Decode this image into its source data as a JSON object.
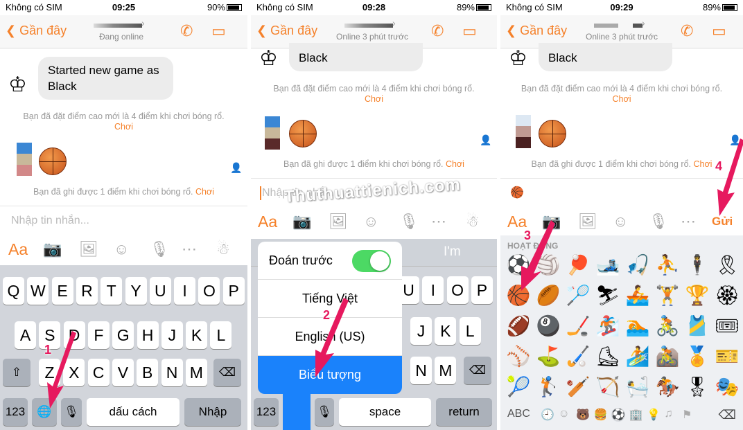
{
  "panels": [
    {
      "carrier": "Không có SIM",
      "time": "09:25",
      "battery": "90%",
      "back": "Gần đây",
      "subtitle": "Đang online"
    },
    {
      "carrier": "Không có SIM",
      "time": "09:28",
      "battery": "89%",
      "back": "Gần đây",
      "subtitle": "Online 3 phút trước"
    },
    {
      "carrier": "Không có SIM",
      "time": "09:29",
      "battery": "89%",
      "back": "Gần đây",
      "subtitle": "Online 3 phút trước"
    }
  ],
  "chat": {
    "game_message": "Started new game as Black",
    "game_message_short": "Black",
    "highscore": "Bạn đã đặt điểm cao mới là 4 điểm khi chơi bóng rổ.",
    "score": "Bạn đã ghi được 1 điểm khi chơi bóng rổ.",
    "play_link": "Chơi",
    "placeholder": "Nhập tin nhắn...",
    "input_value_panel3": "🏀",
    "send": "Gửi",
    "aa": "Aa"
  },
  "keyboard1": {
    "row1": [
      "Q",
      "W",
      "E",
      "R",
      "T",
      "Y",
      "U",
      "I",
      "O",
      "P"
    ],
    "row2": [
      "A",
      "S",
      "D",
      "F",
      "G",
      "H",
      "J",
      "K",
      "L"
    ],
    "row3": [
      "Z",
      "X",
      "C",
      "V",
      "B",
      "N",
      "M"
    ],
    "numbers": "123",
    "space": "dấu cách",
    "return": "Nhập"
  },
  "keyboard2": {
    "suggestion": "I'm",
    "row1": [
      "U",
      "I",
      "O",
      "P"
    ],
    "row2": [
      "J",
      "K",
      "L"
    ],
    "row3": [
      "N",
      "M"
    ],
    "numbers": "123",
    "space": "space",
    "return": "return",
    "menu": {
      "predictive": "Đoán trước",
      "predictive_on": true,
      "options": [
        "Tiếng Việt",
        "English (US)",
        "Biểu tượng"
      ],
      "selected": "Biểu tượng"
    }
  },
  "emoji_keyboard": {
    "category": "HOẠT ĐỘNG",
    "emojis": [
      [
        "⚽",
        "🏐",
        "🏓",
        "🎿",
        "🎣",
        "⛹",
        "🕴",
        "🎗"
      ],
      [
        "🏀",
        "🏉",
        "🏸",
        "⛷",
        "🚣",
        "🏋",
        "🏆",
        "🏵"
      ],
      [
        "🏈",
        "🎱",
        "🏒",
        "🏂",
        "🏊",
        "🚴",
        "🎽",
        "🎟"
      ],
      [
        "⚾",
        "⛳",
        "🏑",
        "⛸",
        "🏄",
        "🚵",
        "🏅",
        "🎫"
      ],
      [
        "🎾",
        "🏌",
        "🏏",
        "🏹",
        "🛀",
        "🏇",
        "🎖",
        "🎭"
      ]
    ],
    "abc": "ABC",
    "categories": [
      "🕘",
      "☺",
      "🐻",
      "🍔",
      "⚽",
      "🏢",
      "💡",
      "♫",
      "⚑"
    ]
  },
  "watermark": "Thuthuattienich.com",
  "steps": [
    "1",
    "2",
    "3",
    "4"
  ],
  "colors": {
    "accent": "#f5812a",
    "arrow": "#e6195e",
    "selected": "#1a82fb",
    "toggle": "#4cd964"
  }
}
